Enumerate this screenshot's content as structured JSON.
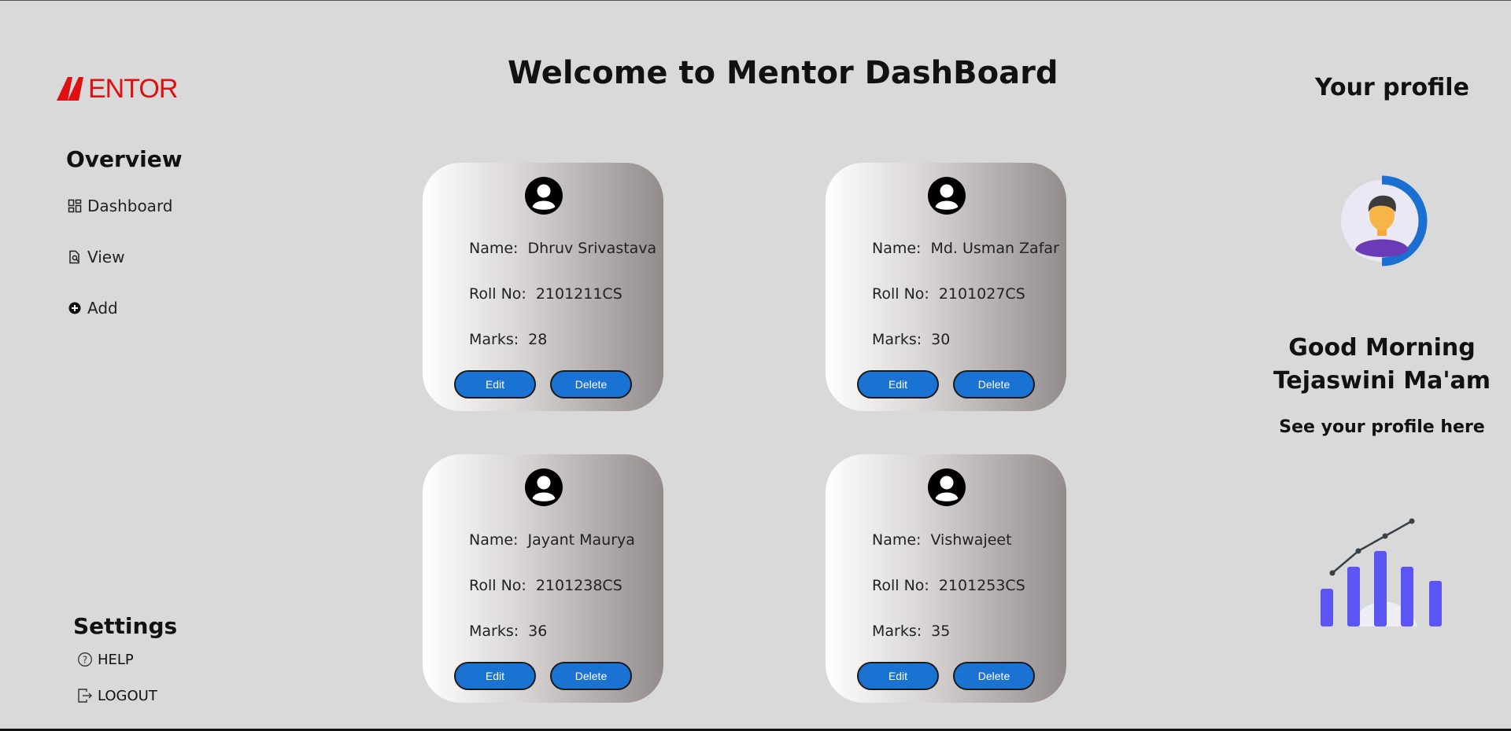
{
  "brand": {
    "logo_text": "ENTOR",
    "logo_color": "#e01010"
  },
  "sidebar": {
    "overview_title": "Overview",
    "nav": [
      {
        "label": "Dashboard",
        "icon": "dashboard-grid-icon"
      },
      {
        "label": "View",
        "icon": "document-search-icon"
      },
      {
        "label": "Add",
        "icon": "plus-circle-icon"
      }
    ],
    "settings_title": "Settings",
    "settings": [
      {
        "label": "HELP",
        "icon": "help-circle-icon"
      },
      {
        "label": "LOGOUT",
        "icon": "logout-icon"
      }
    ]
  },
  "main": {
    "title": "Welcome to Mentor DashBoard",
    "field_labels": {
      "name": "Name:",
      "roll": "Roll No:",
      "marks": "Marks:"
    },
    "buttons": {
      "edit": "Edit",
      "delete": "Delete"
    },
    "students": [
      {
        "name": "Dhruv Srivastava",
        "roll": "2101211CS",
        "marks": "28"
      },
      {
        "name": "Md. Usman Zafar",
        "roll": "2101027CS",
        "marks": "30"
      },
      {
        "name": "Jayant Maurya",
        "roll": "2101238CS",
        "marks": "36"
      },
      {
        "name": "Vishwajeet",
        "roll": "2101253CS",
        "marks": "35"
      }
    ]
  },
  "profile": {
    "title": "Your profile",
    "greeting_line1": "Good Morning",
    "greeting_line2": "Tejaswini Ma'am",
    "subtitle": "See your profile here"
  },
  "colors": {
    "background": "#d9d9d9",
    "button": "#1a72d2",
    "accent_ring": "#1b6fd1",
    "chart_bars": "#5b55f5"
  }
}
